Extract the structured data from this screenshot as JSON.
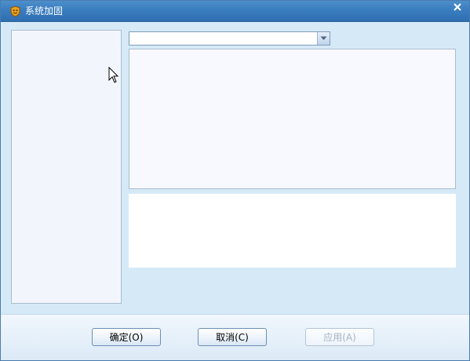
{
  "window": {
    "title": "系统加固",
    "icon": "shield-app-icon",
    "close_icon": "close-icon"
  },
  "filter": {
    "selected_value": ""
  },
  "buttons": {
    "ok_label": "确定(O)",
    "cancel_label": "取消(C)",
    "apply_label": "应用(A)",
    "apply_enabled": false
  },
  "colors": {
    "titlebar": "#3a7dbf",
    "background": "#d6e9f7",
    "border": "#4a7bb0"
  }
}
